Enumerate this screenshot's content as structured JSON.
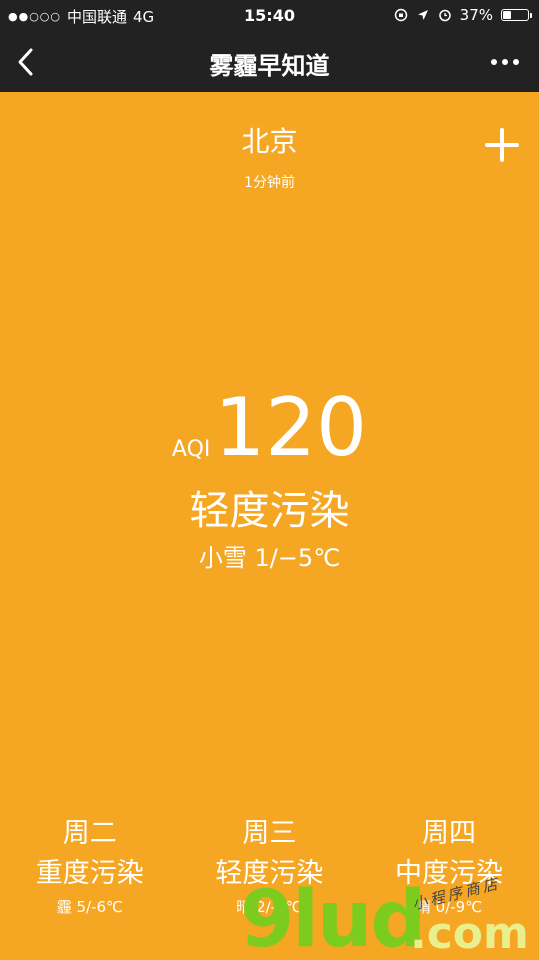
{
  "status_bar": {
    "signal": "●●○○○",
    "carrier": "中国联通",
    "network": "4G",
    "time": "15:40",
    "battery_percent": "37%",
    "battery_level": 0.37,
    "icons": [
      "orientation-lock-icon",
      "location-arrow-icon",
      "alarm-clock-icon",
      "battery-icon"
    ]
  },
  "nav": {
    "title": "雾霾早知道",
    "back_icon": "chevron-left-icon",
    "more_icon": "more-dots-icon"
  },
  "city": {
    "name": "北京",
    "updated": "1分钟前",
    "add_icon": "plus-icon"
  },
  "air": {
    "aqi_label": "AQI",
    "aqi_value": "120",
    "level": "轻度污染",
    "weather": "小雪 1/−5℃"
  },
  "forecast": [
    {
      "day": "周二",
      "level": "重度污染",
      "weather": "霾 5/-6℃"
    },
    {
      "day": "周三",
      "level": "轻度污染",
      "weather": "晴 2/-5℃"
    },
    {
      "day": "周四",
      "level": "中度污染",
      "weather": "晴 0/-9℃"
    }
  ],
  "watermark": {
    "brand": "9lud",
    "suffix": ".com",
    "tagline": "小程序商店"
  },
  "colors": {
    "background": "#f5a623",
    "bar": "#222222",
    "text": "#ffffff",
    "watermark_green": "#7ccc1f"
  }
}
